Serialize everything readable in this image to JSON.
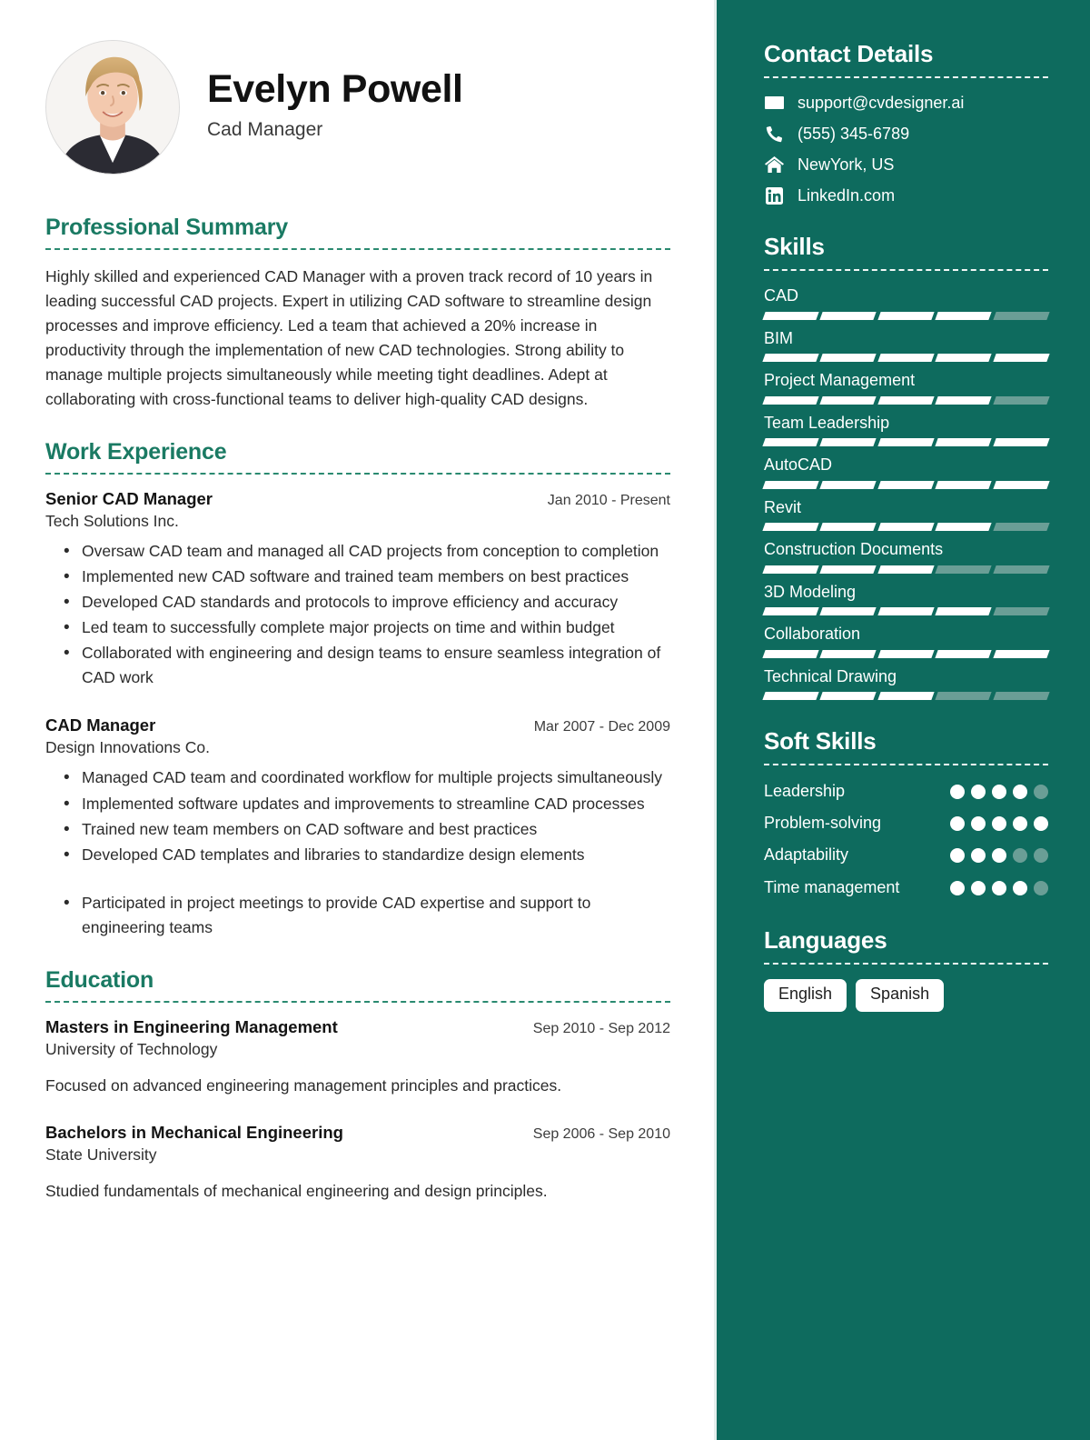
{
  "theme": {
    "sidebar_bg": "#0E6B5E",
    "heading_green": "#1A7A63",
    "muted_segment": "#6A9E96",
    "page_bg": "#FFFFFF"
  },
  "header": {
    "name": "Evelyn Powell",
    "job_title": "Cad Manager",
    "avatar_alt": "profile-photo"
  },
  "summary": {
    "heading": "Professional Summary",
    "text": "Highly skilled and experienced CAD Manager with a proven track record of 10 years in leading successful CAD projects. Expert in utilizing CAD software to streamline design processes and improve efficiency. Led a team that achieved a 20% increase in productivity through the implementation of new CAD technologies. Strong ability to manage multiple projects simultaneously while meeting tight deadlines. Adept at collaborating with cross-functional teams to deliver high-quality CAD designs."
  },
  "work": {
    "heading": "Work Experience",
    "entries": [
      {
        "role": "Senior CAD Manager",
        "date": "Jan 2010 - Present",
        "organization": "Tech Solutions Inc.",
        "bullets": [
          "Oversaw CAD team and managed all CAD projects from conception to completion",
          "Implemented new CAD software and trained team members on best practices",
          "Developed CAD standards and protocols to improve efficiency and accuracy",
          "Led team to successfully complete major projects on time and within budget",
          "Collaborated with engineering and design teams to ensure seamless integration of CAD work"
        ]
      },
      {
        "role": "CAD Manager",
        "date": "Mar 2007 - Dec 2009",
        "organization": "Design Innovations Co.",
        "bullets": [
          "Managed CAD team and coordinated workflow for multiple projects simultaneously",
          "Implemented software updates and improvements to streamline CAD processes",
          "Trained new team members on CAD software and best practices",
          "Developed CAD templates and libraries to standardize design elements",
          "Participated in project meetings to provide CAD expertise and support to engineering teams"
        ]
      }
    ]
  },
  "education": {
    "heading": "Education",
    "entries": [
      {
        "degree": "Masters in Engineering Management",
        "date": "Sep 2010 - Sep 2012",
        "school": "University of Technology",
        "note": "Focused on advanced engineering management principles and practices."
      },
      {
        "degree": "Bachelors in Mechanical Engineering",
        "date": "Sep 2006 - Sep 2010",
        "school": "State University",
        "note": "Studied fundamentals of mechanical engineering and design principles."
      }
    ]
  },
  "contact": {
    "heading": "Contact Details",
    "items": [
      {
        "icon": "envelope-icon",
        "value": "support@cvdesigner.ai"
      },
      {
        "icon": "phone-icon",
        "value": "(555) 345-6789"
      },
      {
        "icon": "home-icon",
        "value": "NewYork, US"
      },
      {
        "icon": "linkedin-icon",
        "value": "LinkedIn.com"
      }
    ]
  },
  "skills": {
    "heading": "Skills",
    "max": 5,
    "items": [
      {
        "label": "CAD",
        "level": 4
      },
      {
        "label": "BIM",
        "level": 5
      },
      {
        "label": "Project Management",
        "level": 4
      },
      {
        "label": "Team Leadership",
        "level": 5
      },
      {
        "label": "AutoCAD",
        "level": 5
      },
      {
        "label": "Revit",
        "level": 4
      },
      {
        "label": "Construction Documents",
        "level": 3
      },
      {
        "label": "3D Modeling",
        "level": 4
      },
      {
        "label": "Collaboration",
        "level": 5
      },
      {
        "label": "Technical Drawing",
        "level": 3
      }
    ]
  },
  "soft_skills": {
    "heading": "Soft Skills",
    "max": 5,
    "items": [
      {
        "label": "Leadership",
        "level": 4
      },
      {
        "label": "Problem-solving",
        "level": 5
      },
      {
        "label": "Adaptability",
        "level": 3
      },
      {
        "label": "Time management",
        "level": 4
      }
    ]
  },
  "languages": {
    "heading": "Languages",
    "items": [
      "English",
      "Spanish"
    ]
  }
}
